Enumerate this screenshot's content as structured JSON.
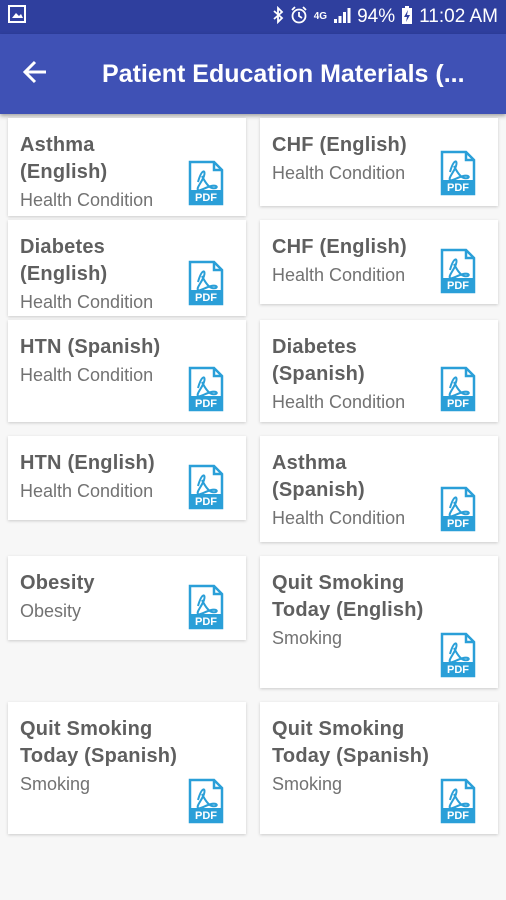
{
  "status": {
    "battery": "94%",
    "time": "11:02 AM",
    "network": "4G"
  },
  "app_bar": {
    "title": "Patient Education Materials (..."
  },
  "materials": [
    {
      "title": "Asthma (English)",
      "category": "Health Condition",
      "icon": "pdf-icon"
    },
    {
      "title": "CHF (English)",
      "category": "Health Condition",
      "icon": "pdf-icon"
    },
    {
      "title": "Diabetes (English)",
      "category": "Health Condition",
      "icon": "pdf-icon"
    },
    {
      "title": "CHF (English)",
      "category": "Health Condition",
      "icon": "pdf-icon"
    },
    {
      "title": "HTN (Spanish)",
      "category": "Health Condition",
      "icon": "pdf-icon"
    },
    {
      "title": "Diabetes (Spanish)",
      "category": "Health Condition",
      "icon": "pdf-icon"
    },
    {
      "title": "HTN (English)",
      "category": "Health Condition",
      "icon": "pdf-icon"
    },
    {
      "title": "Asthma (Spanish)",
      "category": "Health Condition",
      "icon": "pdf-icon"
    },
    {
      "title": "Obesity",
      "category": "Obesity",
      "icon": "pdf-icon"
    },
    {
      "title": "Quit Smoking Today (English)",
      "category": "Smoking",
      "icon": "pdf-icon"
    },
    {
      "title": "Quit Smoking Today (Spanish)",
      "category": "Smoking",
      "icon": "pdf-icon"
    },
    {
      "title": "Quit Smoking Today (Spanish)",
      "category": "Smoking",
      "icon": "pdf-icon"
    }
  ],
  "pdf_label": "PDF",
  "colors": {
    "status_bar": "#2f3f9e",
    "app_bar": "#3f51b5",
    "pdf_blue": "#2a9fd8"
  }
}
